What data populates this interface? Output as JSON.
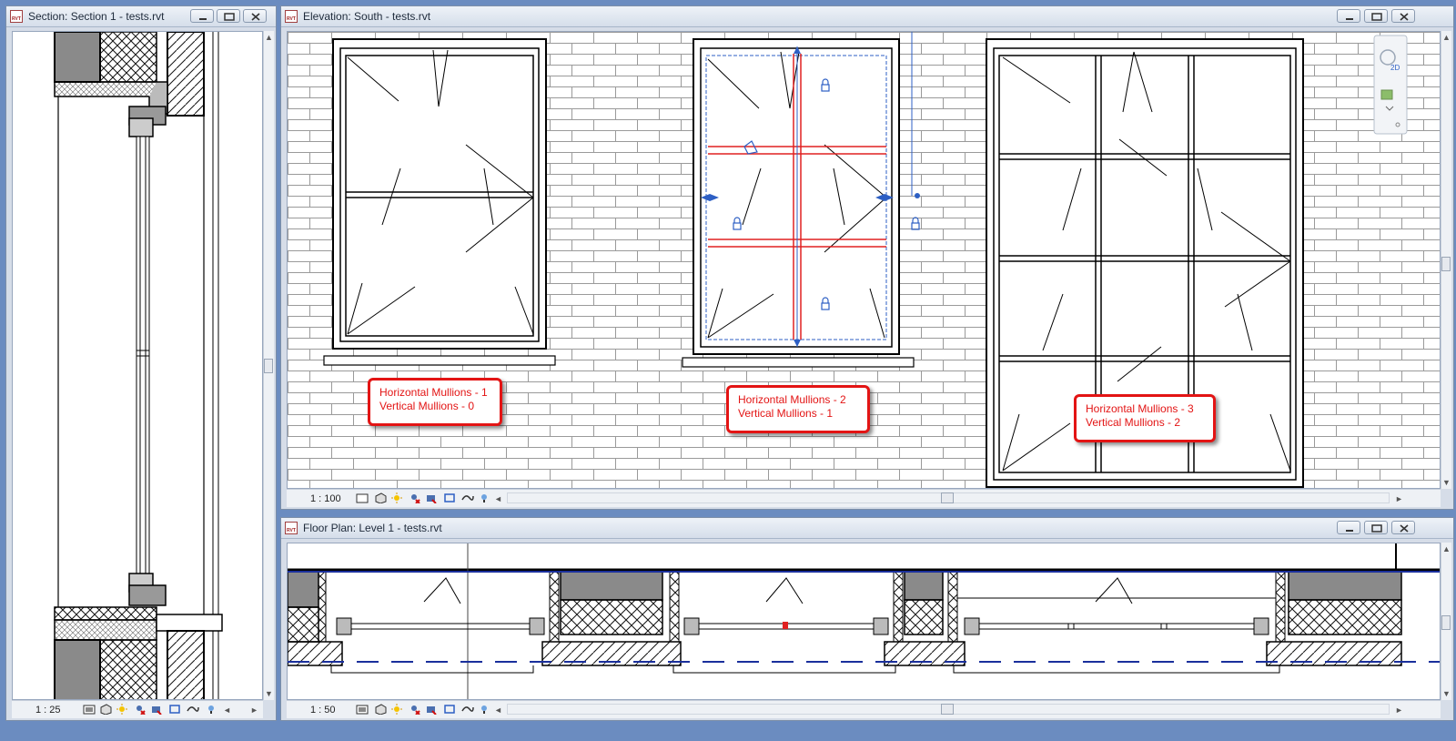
{
  "windows": {
    "section": {
      "title": "Section: Section 1 - tests.rvt",
      "scale": "1 : 25"
    },
    "elevation": {
      "title": "Elevation: South - tests.rvt",
      "scale": "1 : 100",
      "callouts": [
        {
          "line1": "Horizontal Mullions - 1",
          "line2": "Vertical Mullions - 0"
        },
        {
          "line1": "Horizontal Mullions - 2",
          "line2": "Vertical Mullions - 1"
        },
        {
          "line1": "Horizontal Mullions - 3",
          "line2": "Vertical Mullions - 2"
        }
      ],
      "nav_bar_label": "2D"
    },
    "floorplan": {
      "title": "Floor Plan: Level 1 - tests.rvt",
      "scale": "1 : 50"
    }
  },
  "app_icon_label": "RVT",
  "colors": {
    "accent_red": "#e31414",
    "selection_blue": "#2d5fc4",
    "mullion_red": "#e02020",
    "dashed_blue": "#1a2f9c"
  },
  "icons": [
    "minimize-icon",
    "maximize-icon",
    "close-icon",
    "detail-level-icon",
    "visual-style-icon",
    "sun-path-icon",
    "shadows-icon",
    "crop-icon",
    "show-crop-icon",
    "temp-hide-icon",
    "reveal-hidden-icon"
  ]
}
